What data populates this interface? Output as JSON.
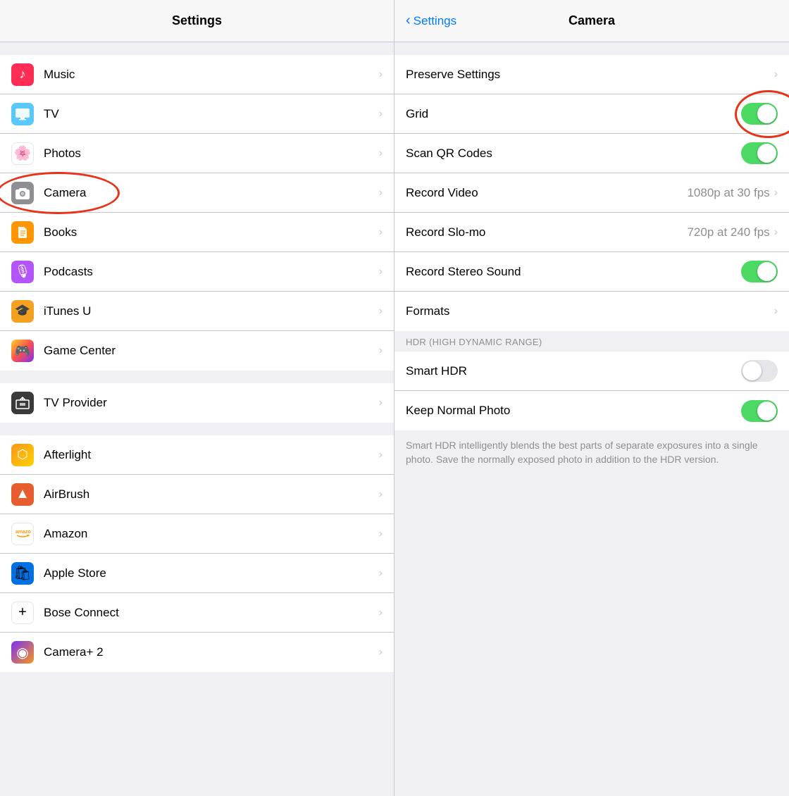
{
  "left": {
    "header": {
      "title": "Settings"
    },
    "mainItems": [
      {
        "id": "music",
        "label": "Music",
        "iconBg": "icon-music",
        "iconChar": "♪",
        "iconColor": "#fff"
      },
      {
        "id": "tv",
        "label": "TV",
        "iconBg": "icon-tv",
        "iconChar": "📺",
        "iconColor": "#fff"
      },
      {
        "id": "photos",
        "label": "Photos",
        "iconBg": "icon-photos",
        "iconChar": "🌸",
        "iconColor": "#000"
      },
      {
        "id": "camera",
        "label": "Camera",
        "iconBg": "icon-camera",
        "iconChar": "📷",
        "iconColor": "#fff"
      },
      {
        "id": "books",
        "label": "Books",
        "iconBg": "icon-books",
        "iconChar": "📖",
        "iconColor": "#fff"
      },
      {
        "id": "podcasts",
        "label": "Podcasts",
        "iconBg": "icon-podcasts",
        "iconChar": "🎙",
        "iconColor": "#fff"
      },
      {
        "id": "itunes-u",
        "label": "iTunes U",
        "iconBg": "icon-itunes-u",
        "iconChar": "🎓",
        "iconColor": "#fff"
      },
      {
        "id": "game-center",
        "label": "Game Center",
        "iconBg": "icon-game-center",
        "iconChar": "🎮",
        "iconColor": "#fff"
      }
    ],
    "tvProvider": {
      "id": "tv-provider",
      "label": "TV Provider",
      "iconBg": "icon-tv-provider",
      "iconChar": "📡",
      "iconColor": "#fff"
    },
    "appItems": [
      {
        "id": "afterlight",
        "label": "Afterlight",
        "iconBg": "icon-afterlight",
        "iconChar": "⬡",
        "iconColor": "#fff"
      },
      {
        "id": "airbrush",
        "label": "AirBrush",
        "iconBg": "icon-airbrush",
        "iconChar": "✦",
        "iconColor": "#fff"
      },
      {
        "id": "amazon",
        "label": "Amazon",
        "iconBg": "icon-amazon",
        "iconChar": "amazon",
        "iconColor": "#000",
        "fontSize": "9px"
      },
      {
        "id": "apple-store",
        "label": "Apple Store",
        "iconBg": "icon-apple-store",
        "iconChar": "🛍",
        "iconColor": "#fff"
      },
      {
        "id": "bose",
        "label": "Bose Connect",
        "iconBg": "icon-bose",
        "iconChar": "+",
        "iconColor": "#000"
      },
      {
        "id": "camera2",
        "label": "Camera+ 2",
        "iconBg": "icon-camera2",
        "iconChar": "◉",
        "iconColor": "#fff"
      }
    ]
  },
  "right": {
    "header": {
      "backLabel": "Settings",
      "title": "Camera"
    },
    "rows": [
      {
        "id": "preserve-settings",
        "label": "Preserve Settings",
        "type": "chevron"
      },
      {
        "id": "grid",
        "label": "Grid",
        "type": "toggle",
        "toggleOn": true,
        "circled": true
      },
      {
        "id": "scan-qr",
        "label": "Scan QR Codes",
        "type": "toggle",
        "toggleOn": true
      },
      {
        "id": "record-video",
        "label": "Record Video",
        "type": "value-chevron",
        "value": "1080p at 30 fps"
      },
      {
        "id": "record-slo-mo",
        "label": "Record Slo-mo",
        "type": "value-chevron",
        "value": "720p at 240 fps"
      },
      {
        "id": "record-stereo",
        "label": "Record Stereo Sound",
        "type": "toggle",
        "toggleOn": true
      },
      {
        "id": "formats",
        "label": "Formats",
        "type": "chevron"
      }
    ],
    "hdrSection": {
      "header": "HDR (HIGH DYNAMIC RANGE)",
      "rows": [
        {
          "id": "smart-hdr",
          "label": "Smart HDR",
          "type": "toggle",
          "toggleOn": false
        },
        {
          "id": "keep-normal",
          "label": "Keep Normal Photo",
          "type": "toggle",
          "toggleOn": true
        }
      ],
      "note": "Smart HDR intelligently blends the best parts of separate exposures into a single photo. Save the normally exposed photo in addition to the HDR version."
    }
  }
}
